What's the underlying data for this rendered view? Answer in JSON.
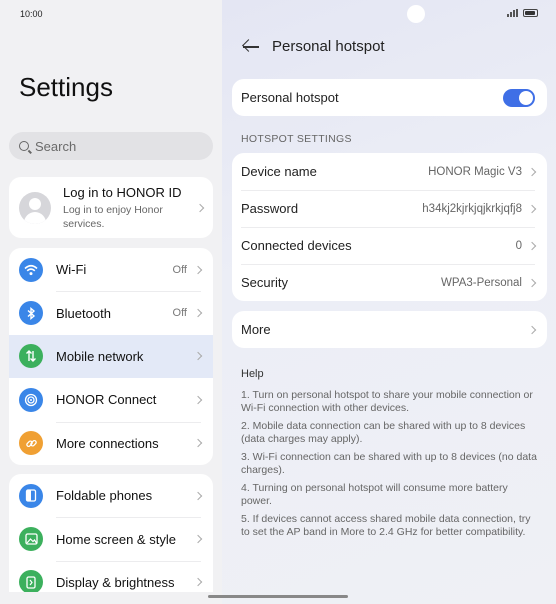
{
  "status": {
    "time": "10:00"
  },
  "left": {
    "title": "Settings",
    "search_placeholder": "Search",
    "account": {
      "title": "Log in to HONOR ID",
      "subtitle": "Log in to enjoy Honor services."
    },
    "group1": [
      {
        "label": "Wi-Fi",
        "value": "Off",
        "icon": "wifi-icon",
        "color": "#3a86e8"
      },
      {
        "label": "Bluetooth",
        "value": "Off",
        "icon": "bluetooth-icon",
        "color": "#3a86e8"
      },
      {
        "label": "Mobile network",
        "value": "",
        "icon": "mobile-data-icon",
        "color": "#3cb05d"
      },
      {
        "label": "HONOR Connect",
        "value": "",
        "icon": "honor-connect-icon",
        "color": "#3a86e8"
      },
      {
        "label": "More connections",
        "value": "",
        "icon": "link-icon",
        "color": "#f0a033"
      }
    ],
    "group2": [
      {
        "label": "Foldable phones",
        "icon": "foldable-icon",
        "color": "#3a86e8"
      },
      {
        "label": "Home screen & style",
        "icon": "image-icon",
        "color": "#3cb05d"
      },
      {
        "label": "Display & brightness",
        "icon": "display-icon",
        "color": "#3cb05d"
      }
    ]
  },
  "right": {
    "title": "Personal hotspot",
    "toggle_label": "Personal hotspot",
    "toggle_on": true,
    "section_header": "HOTSPOT SETTINGS",
    "settings": [
      {
        "label": "Device name",
        "value": "HONOR Magic V3"
      },
      {
        "label": "Password",
        "value": "h34kj2kjrkjqjkrkjqfj8"
      },
      {
        "label": "Connected devices",
        "value": "0"
      },
      {
        "label": "Security",
        "value": "WPA3-Personal"
      }
    ],
    "more_label": "More",
    "help_title": "Help",
    "help_items": [
      "1. Turn on personal hotspot to share your mobile connection or Wi-Fi connection with other devices.",
      "2. Mobile data connection can be shared with up to 8 devices (data charges may apply).",
      "3. Wi-Fi connection can be shared with up to 8 devices (no data charges).",
      "4. Turning on personal hotspot will consume more battery power.",
      "5. If devices cannot access shared mobile data connection, try to set the AP band in More to 2.4 GHz for better compatibility."
    ]
  },
  "colors": {
    "accent": "#3f6fe6",
    "active_row": "#e3e9f7"
  }
}
